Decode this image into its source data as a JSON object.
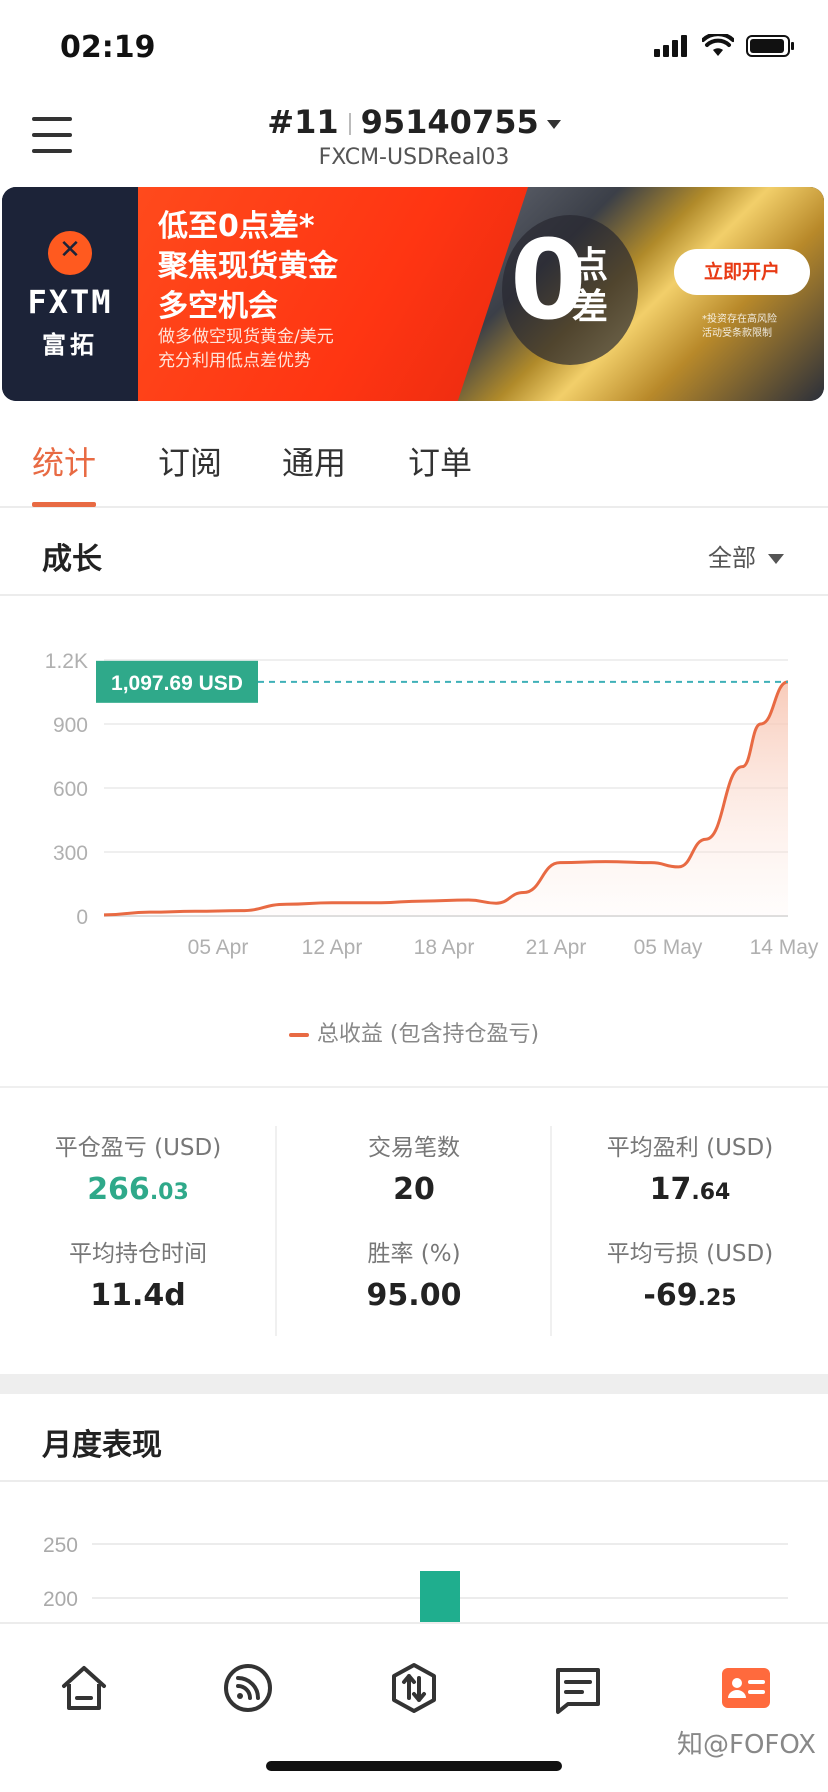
{
  "status_bar": {
    "time": "02:19"
  },
  "header": {
    "account_prefix": "#11",
    "account_number": "95140755",
    "server": "FXCM-USDReal03"
  },
  "banner": {
    "logo_en": "FXTM",
    "logo_cn": "富拓",
    "headline_1": "低至0点差*",
    "headline_2": "聚焦现货黄金",
    "headline_3": "多空机会",
    "sub_1": "做多做空现货黄金/美元",
    "sub_2": "充分利用低点差优势",
    "zero_big": "0",
    "zero_small": "点差",
    "cta": "立即开户",
    "note_1": "*投资存在高风险",
    "note_2": "活动受条款限制"
  },
  "tabs": [
    {
      "label": "统计"
    },
    {
      "label": "订阅"
    },
    {
      "label": "通用"
    },
    {
      "label": "订单"
    }
  ],
  "growth": {
    "title": "成长",
    "filter": "全部",
    "current_value_label": "1,097.69 USD",
    "legend": "总收益 (包含持仓盈亏)"
  },
  "chart_data": {
    "type": "area",
    "y_ticks": [
      "0",
      "300",
      "600",
      "900",
      "1.2K"
    ],
    "x_ticks": [
      "05 Apr",
      "12 Apr",
      "18 Apr",
      "21 Apr",
      "05 May",
      "14 May"
    ],
    "ylim": [
      0,
      1200
    ],
    "x": [
      0,
      0.5,
      1,
      1.5,
      2,
      2.5,
      3,
      3.5,
      4,
      4.3,
      4.6,
      5,
      5.5,
      6,
      6.3,
      6.6,
      7,
      7.2,
      7.5
    ],
    "values": [
      5,
      18,
      22,
      25,
      55,
      62,
      62,
      70,
      75,
      60,
      110,
      250,
      255,
      250,
      230,
      360,
      700,
      900,
      1097.69
    ],
    "series_color": "#e86a43",
    "label_color": "#2fa98a",
    "grid": true
  },
  "stats": {
    "closed_pnl": {
      "label": "平仓盈亏 (USD)",
      "int": "266",
      "dec": ".03"
    },
    "trades": {
      "label": "交易笔数",
      "value": "20"
    },
    "avg_profit": {
      "label": "平均盈利 (USD)",
      "int": "17",
      "dec": ".64"
    },
    "avg_hold": {
      "label": "平均持仓时间",
      "value": "11.4d"
    },
    "win_rate": {
      "label": "胜率 (%)",
      "value": "95.00"
    },
    "avg_loss": {
      "label": "平均亏损 (USD)",
      "int": "-69",
      "dec": ".25"
    }
  },
  "monthly": {
    "title": "月度表现",
    "y_ticks": [
      "250",
      "200"
    ],
    "bar_value": 225,
    "bar_color": "#1fae8e"
  },
  "nav": [
    {
      "icon": "home-icon"
    },
    {
      "icon": "feed-icon"
    },
    {
      "icon": "trade-icon"
    },
    {
      "icon": "message-icon"
    },
    {
      "icon": "profile-card-icon"
    }
  ],
  "watermark": "知@FOFOX"
}
